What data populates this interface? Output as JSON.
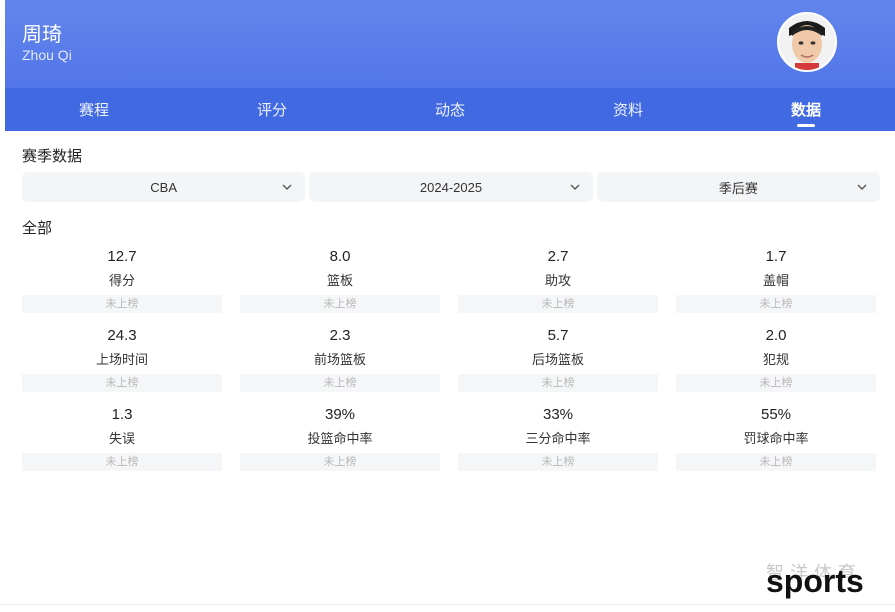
{
  "player": {
    "name": "周琦",
    "name_en": "Zhou Qi"
  },
  "tabs": [
    {
      "label": "赛程",
      "active": false
    },
    {
      "label": "评分",
      "active": false
    },
    {
      "label": "动态",
      "active": false
    },
    {
      "label": "资料",
      "active": false
    },
    {
      "label": "数据",
      "active": true
    }
  ],
  "season": {
    "title": "赛季数据",
    "filters": [
      {
        "value": "CBA",
        "icon": "chevron-down-icon"
      },
      {
        "value": "2024-2025",
        "icon": "chevron-down-icon"
      },
      {
        "value": "季后赛",
        "icon": "chevron-down-icon"
      }
    ]
  },
  "stats": {
    "group_title": "全部",
    "items": [
      {
        "value": "12.7",
        "label": "得分",
        "rank": "未上榜"
      },
      {
        "value": "8.0",
        "label": "篮板",
        "rank": "未上榜"
      },
      {
        "value": "2.7",
        "label": "助攻",
        "rank": "未上榜"
      },
      {
        "value": "1.7",
        "label": "盖帽",
        "rank": "未上榜"
      },
      {
        "value": "24.3",
        "label": "上场时间",
        "rank": "未上榜"
      },
      {
        "value": "2.3",
        "label": "前场篮板",
        "rank": "未上榜"
      },
      {
        "value": "5.7",
        "label": "后场篮板",
        "rank": "未上榜"
      },
      {
        "value": "2.0",
        "label": "犯规",
        "rank": "未上榜"
      },
      {
        "value": "1.3",
        "label": "失误",
        "rank": "未上榜"
      },
      {
        "value": "39%",
        "label": "投篮命中率",
        "rank": "未上榜"
      },
      {
        "value": "33%",
        "label": "三分命中率",
        "rank": "未上榜"
      },
      {
        "value": "55%",
        "label": "罚球命中率",
        "rank": "未上榜"
      }
    ]
  },
  "watermark": {
    "cn": "智洋体育",
    "en": "sports"
  },
  "colors": {
    "header_top": "#6285ec",
    "tab_bar": "#4169e1",
    "filter_bg": "#f4f5f7",
    "rank_text": "#b8b8b8"
  }
}
